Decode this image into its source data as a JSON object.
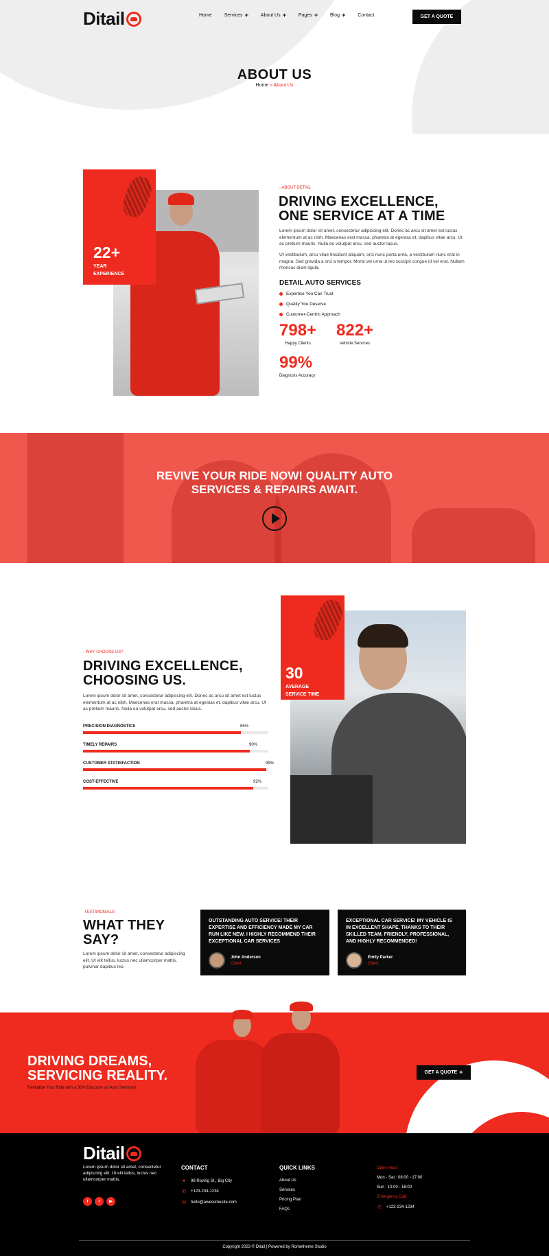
{
  "brand": {
    "name": "Ditail",
    "accent": "#ef2b1f"
  },
  "nav": {
    "items": [
      {
        "label": "Home",
        "has_sub": false
      },
      {
        "label": "Services",
        "has_sub": true
      },
      {
        "label": "About Us",
        "has_sub": true
      },
      {
        "label": "Pages",
        "has_sub": true
      },
      {
        "label": "Blog",
        "has_sub": true
      },
      {
        "label": "Contact",
        "has_sub": false
      }
    ],
    "cta": "GET A QUOTE"
  },
  "page": {
    "title": "ABOUT US",
    "breadcrumb_home": "Home",
    "breadcrumb_sep": " » ",
    "breadcrumb_current": "About Us"
  },
  "about": {
    "exp_number": "22+",
    "exp_line1": "YEAR",
    "exp_line2": "EXPERIENCE",
    "eyebrow": "- ABOUT DETAIL",
    "title_line1": "DRIVING EXCELLENCE,",
    "title_line2": "ONE SERVICE AT A TIME",
    "para1": "Lorem ipsum dolor sit amet, consectetur adipiscing elit. Donec ac arcu sit amet est luctus elementum at ac nibh. Maecenas erat massa, pharetra at egestas et, dapibus vitae arcu. Ut ac pretium mauris. Nulla eu volutpat arcu, sed auctor lacus.",
    "para2": "Ut vestibulum, arcu vitae tincidunt aliquam, orci nunc porta urna, a vestibulum nunc erat in magna. Sed gravida a orci a tempor. Morbi vel urna ut leo suscipit congue id vel erat. Nullam rhoncus diam ligula.",
    "services_title": "DETAIL AUTO SERVICES",
    "bullets": [
      "Expertise You Can Trust",
      "Quality You Deserve",
      "Customer-Centric Approach"
    ],
    "stats": [
      {
        "value": "798+",
        "label": "Happy Clients"
      },
      {
        "value": "822+",
        "label": "Vehicle Services"
      },
      {
        "value": "99%",
        "label": "Diagnosis Accuracy"
      }
    ]
  },
  "banner": {
    "line1": "REVIVE YOUR RIDE NOW! QUALITY AUTO",
    "line2": "SERVICES & REPAIRS AWAIT."
  },
  "why": {
    "eyebrow": "- WHY CHOOSE US?",
    "title_line1": "DRIVING EXCELLENCE,",
    "title_line2": "CHOOSING US.",
    "para": "Lorem ipsum dolor sit amet, consectetur adipiscing elit. Donec ac arcu sit amet est luctus elementum at ac nibh. Maecenas erat massa, pharetra at egestas et, dapibus vitae arcu. Ut ac pretium mauris. Nulla eu volutpat arcu, sed auctor lacus.",
    "avg_number": "30",
    "avg_line1": "AVERAGE",
    "avg_line2": "SERVICE TIME",
    "bars": [
      {
        "label": "PRECISION DIAGNOSTICS",
        "value": 85,
        "text": "85%"
      },
      {
        "label": "TIMELY REPAIRS",
        "value": 90,
        "text": "90%"
      },
      {
        "label": "CUSTOMER STATISFACTION",
        "value": 99,
        "text": "99%"
      },
      {
        "label": "COST-EFFECTIVE",
        "value": 92,
        "text": "92%"
      }
    ]
  },
  "testimonials": {
    "eyebrow": "-TESTIMONIALS",
    "title_line1": "WHAT THEY",
    "title_line2": "SAY?",
    "para": "Lorem ipsum dolor sit amet, consectetur adipiscing elit. Ut elit tellus, luctus nec ullamcorper mattis, pulvinar dapibus leo.",
    "cards": [
      {
        "quote": "OUTSTANDING AUTO SERVICE! THEIR EXPERTISE AND EFFICIENCY MADE MY CAR RUN LIKE NEW. I HIGHLY RECOMMEND THEIR EXCEPTIONAL CAR SERVICES",
        "name": "John Anderson",
        "role": "Client"
      },
      {
        "quote": "EXCEPTIONAL CAR SERVICE! MY VEHICLE IS IN EXCELLENT SHAPE, THANKS TO THEIR SKILLED TEAM. FRIENDLY, PROFESSIONAL, AND HIGHLY RECOMMENDED!",
        "name": "Emily Parker",
        "role": "Client"
      }
    ]
  },
  "cta": {
    "title_line1": "DRIVING DREAMS,",
    "title_line2": "SERVICING REALITY.",
    "sub": "Revitalize Your Ride with a 30% Discount on Auto Services!",
    "button": "GET A QUOTE"
  },
  "footer": {
    "about": "Lorem ipsum dolor sit amet, consectetur adipiscing elit. Ut elit tellus, luctus nec ullamcorper mattis.",
    "contact_title": "CONTACT",
    "address": "99 Roving St., Big City",
    "phone": "+123-234-1234",
    "email": "hello@awesomesite.com",
    "links_title": "QUICK LINKS",
    "links": [
      "About Us",
      "Services",
      "Pricing Plan",
      "FAQs"
    ],
    "open_title": "Open Hour:",
    "open_1": "Mon - Sat : 08:00 - 17:00",
    "open_2": "Sun : 10:00 - 16:00",
    "emergency_title": "Emergency Call:",
    "emergency_phone": "+123-234-1234",
    "copyright": "Copyright 2023 © Ditail | Powered by Rometheme Studio"
  }
}
